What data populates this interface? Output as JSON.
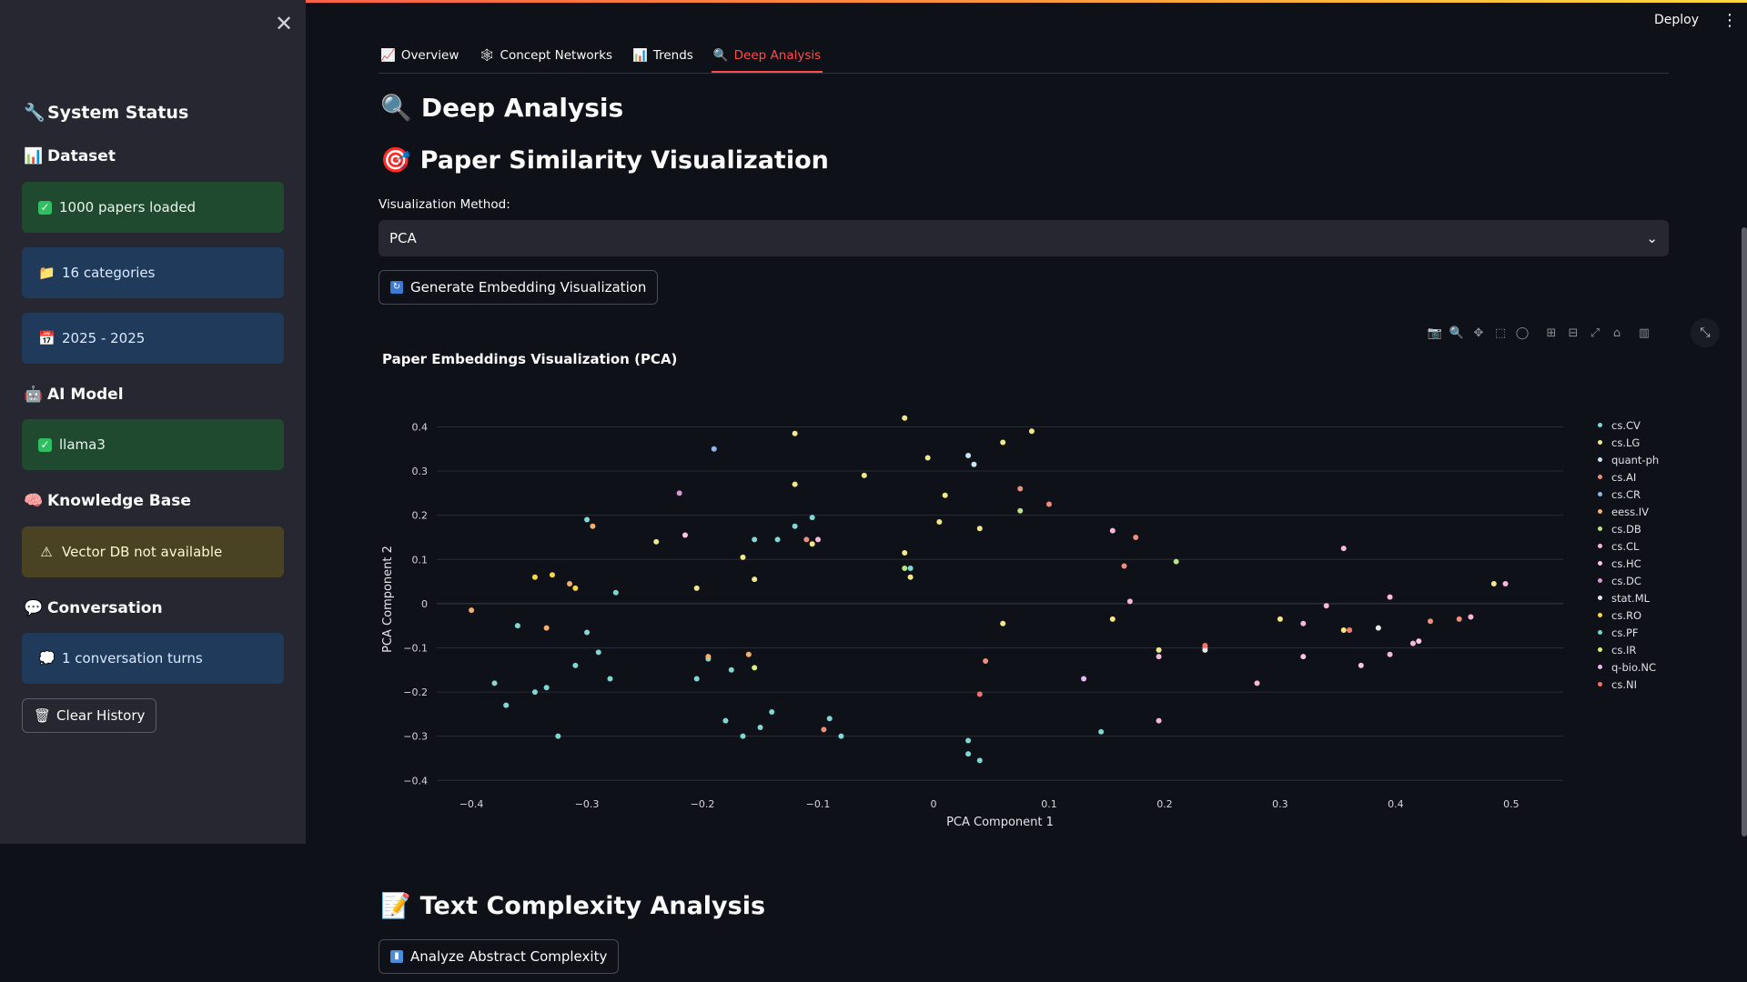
{
  "app": {
    "deploy_label": "Deploy",
    "menu_icon": "kebab-menu-icon"
  },
  "sidebar": {
    "system_status": "System Status",
    "dataset_title": "Dataset",
    "papers_loaded": "1000 papers loaded",
    "categories": "16 categories",
    "years": "2025 - 2025",
    "ai_model_title": "AI Model",
    "model_name": "llama3",
    "kb_title": "Knowledge Base",
    "kb_status": "Vector DB not available",
    "conversation_title": "Conversation",
    "conversation_turns": "1 conversation turns",
    "clear_history": "Clear History"
  },
  "tabs": [
    {
      "label": "Overview",
      "icon": "📈"
    },
    {
      "label": "Concept Networks",
      "icon": "🕸"
    },
    {
      "label": "Trends",
      "icon": "📊"
    },
    {
      "label": "Deep Analysis",
      "icon": "🔍"
    }
  ],
  "main": {
    "page_title": "Deep Analysis",
    "section_similarity": "Paper Similarity Visualization",
    "method_label": "Visualization Method:",
    "method_value": "PCA",
    "generate_button": "Generate Embedding Visualization",
    "section_complexity": "Text Complexity Analysis",
    "analyze_button": "Analyze Abstract Complexity"
  },
  "colors": {
    "accent": "#ff4b4b"
  },
  "chart_data": {
    "type": "scatter",
    "title": "Paper Embeddings Visualization (PCA)",
    "xlabel": "PCA Component 1",
    "ylabel": "PCA Component 2",
    "xlim": [
      -0.43,
      0.545
    ],
    "ylim": [
      -0.42,
      0.44
    ],
    "xticks": [
      -0.4,
      -0.3,
      -0.2,
      -0.1,
      0,
      0.1,
      0.2,
      0.3,
      0.4,
      0.5
    ],
    "yticks": [
      -0.4,
      -0.3,
      -0.2,
      -0.1,
      0,
      0.1,
      0.2,
      0.3,
      0.4
    ],
    "xtick_labels": [
      "−0.4",
      "−0.3",
      "−0.2",
      "−0.1",
      "0",
      "0.1",
      "0.2",
      "0.3",
      "0.4",
      "0.5"
    ],
    "ytick_labels": [
      "−0.4",
      "−0.3",
      "−0.2",
      "−0.1",
      "0",
      "0.1",
      "0.2",
      "0.3",
      "0.4"
    ],
    "grid": true,
    "legend_position": "right",
    "series": [
      {
        "name": "cs.CV",
        "color": "#7fd8d4",
        "points": [
          [
            -0.3,
            0.19
          ],
          [
            -0.38,
            -0.18
          ],
          [
            -0.37,
            -0.23
          ],
          [
            -0.36,
            -0.05
          ],
          [
            -0.345,
            -0.2
          ],
          [
            -0.335,
            -0.19
          ],
          [
            -0.325,
            -0.3
          ],
          [
            -0.31,
            -0.14
          ],
          [
            -0.3,
            -0.065
          ],
          [
            -0.29,
            -0.11
          ],
          [
            -0.28,
            -0.17
          ],
          [
            -0.205,
            -0.17
          ],
          [
            -0.195,
            -0.125
          ],
          [
            -0.18,
            -0.265
          ],
          [
            -0.175,
            -0.15
          ],
          [
            -0.165,
            -0.3
          ],
          [
            -0.155,
            0.145
          ],
          [
            -0.15,
            -0.28
          ],
          [
            -0.14,
            -0.245
          ],
          [
            -0.135,
            0.145
          ],
          [
            -0.12,
            0.175
          ],
          [
            -0.105,
            0.195
          ],
          [
            -0.09,
            -0.26
          ],
          [
            -0.08,
            -0.3
          ],
          [
            -0.02,
            0.08
          ],
          [
            0.03,
            -0.31
          ],
          [
            0.03,
            -0.34
          ],
          [
            0.04,
            -0.355
          ],
          [
            0.145,
            -0.29
          ]
        ]
      },
      {
        "name": "cs.LG",
        "color": "#f2e88a",
        "points": [
          [
            -0.24,
            0.14
          ],
          [
            -0.205,
            0.035
          ],
          [
            -0.165,
            0.105
          ],
          [
            -0.155,
            0.055
          ],
          [
            -0.12,
            0.27
          ],
          [
            -0.12,
            0.385
          ],
          [
            -0.105,
            0.135
          ],
          [
            -0.06,
            0.29
          ],
          [
            -0.025,
            0.42
          ],
          [
            -0.025,
            0.115
          ],
          [
            -0.02,
            0.06
          ],
          [
            -0.005,
            0.33
          ],
          [
            0.005,
            0.185
          ],
          [
            0.01,
            0.245
          ],
          [
            0.04,
            0.17
          ],
          [
            0.06,
            0.365
          ],
          [
            0.06,
            -0.045
          ],
          [
            0.085,
            0.39
          ],
          [
            0.155,
            -0.035
          ],
          [
            0.195,
            -0.105
          ],
          [
            0.3,
            -0.035
          ],
          [
            0.355,
            -0.06
          ],
          [
            0.485,
            0.045
          ]
        ]
      },
      {
        "name": "quant-ph",
        "color": "#c8e6f5",
        "points": [
          [
            0.03,
            0.335
          ],
          [
            0.035,
            0.315
          ]
        ]
      },
      {
        "name": "cs.AI",
        "color": "#f08e7c",
        "points": [
          [
            -0.11,
            0.145
          ],
          [
            -0.095,
            -0.285
          ],
          [
            0.045,
            -0.13
          ],
          [
            0.075,
            0.26
          ],
          [
            0.1,
            0.225
          ],
          [
            0.165,
            0.085
          ],
          [
            0.175,
            0.15
          ],
          [
            0.235,
            -0.1
          ],
          [
            0.43,
            -0.04
          ],
          [
            0.455,
            -0.035
          ]
        ]
      },
      {
        "name": "cs.CR",
        "color": "#8fb8e8",
        "points": [
          [
            -0.19,
            0.35
          ]
        ]
      },
      {
        "name": "eess.IV",
        "color": "#f5b070",
        "points": [
          [
            -0.4,
            -0.015
          ],
          [
            -0.335,
            -0.055
          ],
          [
            -0.315,
            0.045
          ],
          [
            -0.295,
            0.175
          ],
          [
            -0.195,
            -0.12
          ],
          [
            -0.16,
            -0.115
          ]
        ]
      },
      {
        "name": "cs.DB",
        "color": "#b8e486",
        "points": [
          [
            -0.025,
            0.08
          ],
          [
            0.075,
            0.21
          ],
          [
            0.21,
            0.095
          ]
        ]
      },
      {
        "name": "cs.CL",
        "color": "#f6b7d8",
        "points": [
          [
            -0.1,
            0.145
          ],
          [
            0.155,
            0.165
          ],
          [
            0.17,
            0.005
          ],
          [
            0.195,
            -0.12
          ],
          [
            0.195,
            -0.265
          ],
          [
            0.28,
            -0.18
          ],
          [
            0.32,
            -0.045
          ],
          [
            0.34,
            -0.005
          ],
          [
            0.355,
            0.125
          ],
          [
            0.395,
            0.015
          ],
          [
            0.395,
            -0.115
          ],
          [
            0.415,
            -0.09
          ],
          [
            0.465,
            -0.03
          ],
          [
            0.495,
            0.045
          ]
        ]
      },
      {
        "name": "cs.HC",
        "color": "#fbc3e4",
        "points": [
          [
            -0.215,
            0.155
          ],
          [
            0.32,
            -0.12
          ],
          [
            0.37,
            -0.14
          ],
          [
            0.42,
            -0.085
          ]
        ]
      },
      {
        "name": "cs.DC",
        "color": "#d99ad0",
        "points": [
          [
            -0.22,
            0.25
          ]
        ]
      },
      {
        "name": "stat.ML",
        "color": "#e6e8ec",
        "points": [
          [
            0.235,
            -0.105
          ],
          [
            0.385,
            -0.055
          ]
        ]
      },
      {
        "name": "cs.RO",
        "color": "#f5d84a",
        "points": [
          [
            -0.33,
            0.065
          ],
          [
            -0.345,
            0.06
          ],
          [
            -0.31,
            0.035
          ]
        ]
      },
      {
        "name": "cs.PF",
        "color": "#7ad7ce",
        "points": [
          [
            -0.275,
            0.025
          ]
        ]
      },
      {
        "name": "cs.IR",
        "color": "#d9f07e",
        "points": [
          [
            -0.155,
            -0.145
          ],
          [
            0.36,
            -0.06
          ]
        ]
      },
      {
        "name": "q-bio.NC",
        "color": "#e4b8f0",
        "points": [
          [
            0.13,
            -0.17
          ]
        ]
      },
      {
        "name": "cs.NI",
        "color": "#f0736e",
        "points": [
          [
            0.04,
            -0.205
          ],
          [
            0.235,
            -0.095
          ],
          [
            0.36,
            -0.06
          ]
        ]
      }
    ]
  }
}
